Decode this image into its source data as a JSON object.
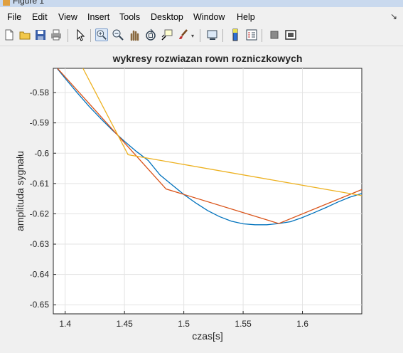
{
  "window": {
    "title": "Figure 1"
  },
  "menu": [
    "File",
    "Edit",
    "View",
    "Insert",
    "Tools",
    "Desktop",
    "Window",
    "Help"
  ],
  "toolbar": {
    "icons": [
      "new-file-icon",
      "open-file-icon",
      "save-icon",
      "print-icon",
      "pointer-icon",
      "zoom-in-icon",
      "zoom-out-icon",
      "pan-icon",
      "rotate-icon",
      "data-cursor-icon",
      "brush-icon",
      "link-plot-icon",
      "colorbar-icon",
      "legend-icon",
      "hide-plot-tools-icon",
      "show-plot-tools-icon"
    ]
  },
  "chart_data": {
    "type": "line",
    "title": "wykresy rozwiazan rown rozniczkowych",
    "xlabel": "czas[s]",
    "ylabel": "amplituda sygnału",
    "xlim": [
      1.39,
      1.65
    ],
    "ylim": [
      -0.653,
      -0.572
    ],
    "grid": true,
    "xticks": [
      1.4,
      1.45,
      1.5,
      1.55,
      1.6
    ],
    "yticks": [
      -0.58,
      -0.59,
      -0.6,
      -0.61,
      -0.62,
      -0.63,
      -0.64,
      -0.65
    ],
    "xtick_labels": [
      "1.4",
      "1.45",
      "1.5",
      "1.55",
      "1.6"
    ],
    "ytick_labels": [
      "-0.58",
      "-0.59",
      "-0.6",
      "-0.61",
      "-0.62",
      "-0.63",
      "-0.64",
      "-0.65"
    ],
    "series": [
      {
        "color": "#0072bd",
        "x": [
          1.39,
          1.4,
          1.41,
          1.42,
          1.43,
          1.44,
          1.45,
          1.46,
          1.47,
          1.48,
          1.49,
          1.5,
          1.51,
          1.52,
          1.53,
          1.54,
          1.55,
          1.56,
          1.57,
          1.58,
          1.59,
          1.6,
          1.61,
          1.62,
          1.63,
          1.64,
          1.65
        ],
        "y": [
          -0.5705,
          -0.5753,
          -0.58,
          -0.5845,
          -0.5886,
          -0.5925,
          -0.5961,
          -0.5994,
          -0.6024,
          -0.6072,
          -0.6104,
          -0.6136,
          -0.6164,
          -0.6189,
          -0.6209,
          -0.6224,
          -0.6233,
          -0.6236,
          -0.6236,
          -0.6232,
          -0.6226,
          -0.6212,
          -0.6196,
          -0.6179,
          -0.6161,
          -0.6145,
          -0.6133
        ]
      },
      {
        "color": "#d95319",
        "x": [
          1.39,
          1.485,
          1.58,
          1.65
        ],
        "y": [
          -0.5705,
          -0.6118,
          -0.6232,
          -0.612
        ]
      },
      {
        "color": "#edb120",
        "x": [
          1.415,
          1.453,
          1.65
        ],
        "y": [
          -0.572,
          -0.6005,
          -0.614
        ]
      }
    ]
  }
}
